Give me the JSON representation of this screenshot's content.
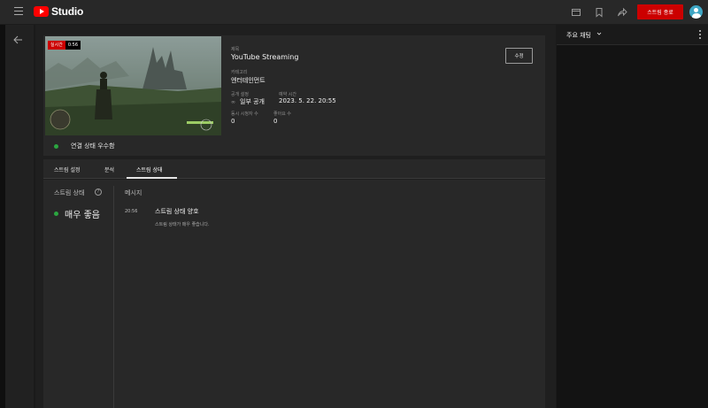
{
  "header": {
    "brand": "Studio",
    "end_stream_label": "스트림 종료"
  },
  "video": {
    "live_label": "실시간",
    "live_time": "0:56",
    "connection_status": "연결 상태 우수함",
    "edit_label": "수정",
    "title_label": "제목",
    "title": "YouTube Streaming",
    "category_label": "카테고리",
    "category": "엔터테인먼트",
    "visibility_label": "공개 설정",
    "visibility": "일부 공개",
    "scheduled_label": "예약 시간",
    "scheduled": "2023. 5. 22. 20:55",
    "concurrent_label": "동시 시청자 수",
    "concurrent": "0",
    "likes_label": "좋아요 수",
    "likes": "0"
  },
  "tabs": [
    {
      "label": "스트림 설정"
    },
    {
      "label": "분석"
    },
    {
      "label": "스트림 상태",
      "active": true
    }
  ],
  "health": {
    "section_label": "스트림 상태",
    "value": "매우 좋음",
    "messages_label": "메시지",
    "message_time": "20:56",
    "message_title": "스트림 상태 양호",
    "message_body": "스트림 상태가 매우 좋습니다."
  },
  "chat": {
    "title": "주요 채팅"
  },
  "colors": {
    "accent_red": "#cc0000",
    "status_green": "#2ba640"
  }
}
